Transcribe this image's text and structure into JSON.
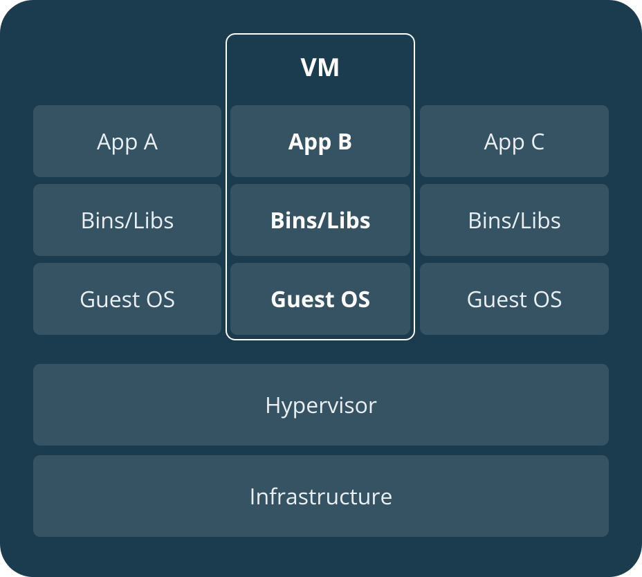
{
  "vm_label": "VM",
  "columns": [
    {
      "app": "App A",
      "bins": "Bins/Libs",
      "os": "Guest OS",
      "highlight": false
    },
    {
      "app": "App B",
      "bins": "Bins/Libs",
      "os": "Guest OS",
      "highlight": true
    },
    {
      "app": "App C",
      "bins": "Bins/Libs",
      "os": "Guest OS",
      "highlight": false
    }
  ],
  "base_layers": {
    "hypervisor": "Hypervisor",
    "infrastructure": "Infrastructure"
  }
}
